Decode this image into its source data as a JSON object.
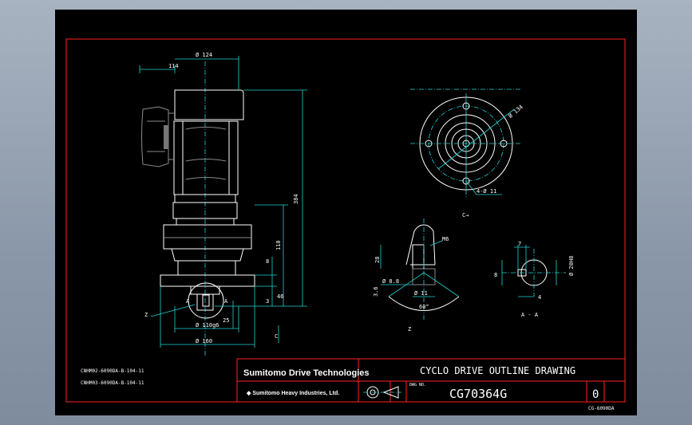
{
  "dims": {
    "d124": "Ø 124",
    "d114": "114",
    "d384": "384",
    "d110": "110",
    "d8": "8",
    "d3": "3",
    "d46": "46",
    "d25": "25",
    "d110g6": "Ø 110g6",
    "d160": "Ø 160",
    "d134": "Ø 134",
    "d4x11": "4-Ø 11",
    "m6": "M6",
    "d28": "28",
    "d3p6": "3.6",
    "d8p8": "Ø 8.8",
    "d11": "Ø 11",
    "ang60": "60°",
    "d7": "7",
    "d8b": "8",
    "d4": "4",
    "d20h8": "Ø 20H8"
  },
  "labels": {
    "c": "C",
    "c_arrow": "C→",
    "a": "A",
    "a2": "A",
    "z": "Z",
    "z2": "Z",
    "aa": "A - A",
    "note1": "CNHM02-6090DA-B-104-11",
    "note2": "CNHM03-6090DA-B-104-11",
    "sheet_code": "CG-6090DA"
  },
  "titleblock": {
    "brand": "Sumitomo Drive Technologies",
    "company": "◆ Sumitomo Heavy Industries, Ltd.",
    "title": "CYCLO DRIVE OUTLINE DRAWING",
    "dwg_label": "DWG NO.",
    "dwg_no": "CG70364G",
    "rev": "0"
  },
  "colors": {
    "background": "#000000",
    "border": "#ff2020",
    "lines": "#ffffff",
    "centerlines": "#1fd3d3",
    "hidden": "#8a8a8a"
  }
}
